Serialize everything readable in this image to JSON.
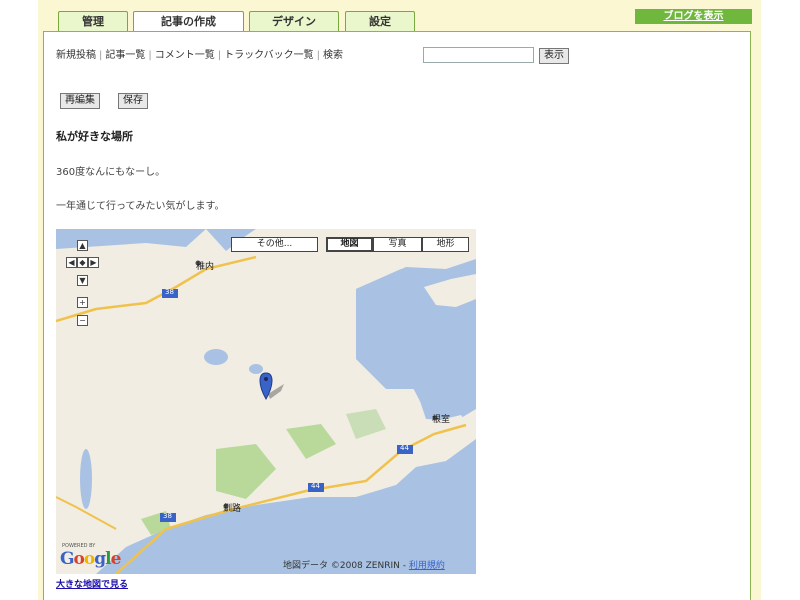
{
  "tabs": [
    {
      "label": "管理",
      "active": false
    },
    {
      "label": "記事の作成",
      "active": true
    },
    {
      "label": "デザイン",
      "active": false
    },
    {
      "label": "設定",
      "active": false
    }
  ],
  "header": {
    "view_blog_label": "ブログを表示"
  },
  "subnav": {
    "items": [
      "新規投稿",
      "記事一覧",
      "コメント一覧",
      "トラックバック一覧",
      "検索"
    ],
    "separator": "|",
    "search_placeholder": "",
    "show_button_label": "表示"
  },
  "actions": {
    "reedit_label": "再編集",
    "save_label": "保存"
  },
  "post": {
    "title": "私が好きな場所",
    "line1": "360度なんにもなーし。",
    "line2": "一年通じて行ってみたい気がします。"
  },
  "map": {
    "more_label": "その他...",
    "type_map_label": "地図",
    "type_satellite_label": "写真",
    "type_terrain_label": "地形",
    "active_type": "地図",
    "place_labels": [
      "稚内",
      "根室",
      "釧路"
    ],
    "road_labels": [
      "38",
      "44",
      "44",
      "38"
    ],
    "credit": "地図データ ©2008 ZENRIN -",
    "terms_label": "利用規約",
    "powered_by": "POWERED BY",
    "logo_text": "Google",
    "larger_map_link": "大きな地図で見る",
    "colors": {
      "water": "#a9c2e3",
      "land": "#f1ede2",
      "road": "#f0c24c",
      "forest": "#b9d99a"
    }
  }
}
